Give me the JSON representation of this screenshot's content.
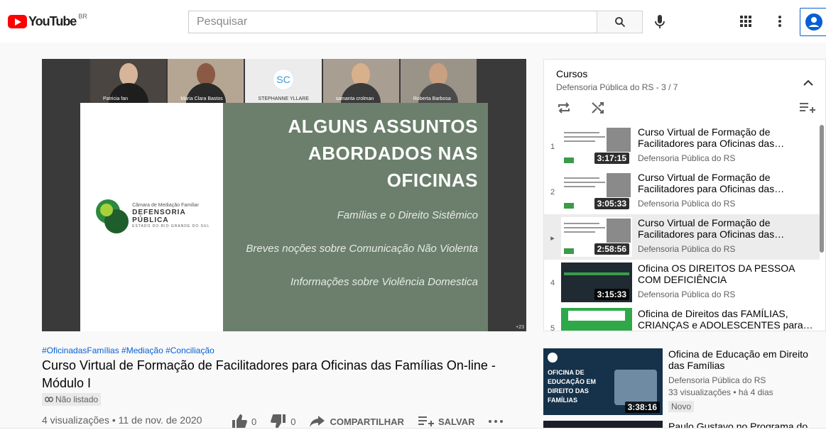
{
  "header": {
    "logo_text": "YouTube",
    "logo_country": "BR",
    "search_placeholder": "Pesquisar"
  },
  "player": {
    "participants": [
      "Patricia fan",
      "Maria Clara Bastos",
      "STEPHANNE YLLARE",
      "samanta crolman",
      "Roberta Barbosa"
    ],
    "initials": "SC",
    "slide_title_lines": [
      "ALGUNS ASSUNTOS",
      "ABORDADOS NAS",
      "OFICINAS"
    ],
    "slide_items": [
      "Famílias e o Direito Sistêmico",
      "Breves noções sobre Comunicação Não Violenta",
      "Informações sobre Violência Domestica"
    ],
    "logo_sub": "Câmara de Mediação Familiar",
    "logo_name": "DEFENSORIA PÚBLICA",
    "logo_state": "ESTADO DO RIO GRANDE DO SUL",
    "participants_badge": "+23"
  },
  "video": {
    "tags": "#OficinadasFamílias #Mediação #Conciliação",
    "title": "Curso Virtual de Formação de Facilitadores para Oficinas das Famílias On-line - Módulo I",
    "unlisted": "Não listado",
    "meta": "4 visualizações • 11 de nov. de 2020",
    "likes": "0",
    "dislikes": "0",
    "share": "COMPARTILHAR",
    "save": "SALVAR"
  },
  "playlist": {
    "title": "Cursos",
    "subtitle": "Defensoria Pública do RS - 3 / 7",
    "items": [
      {
        "index": "1",
        "title": "Curso Virtual de Formação de Facilitadores para Oficinas das…",
        "channel": "Defensoria Pública do RS",
        "duration": "3:17:15",
        "thumb": "white"
      },
      {
        "index": "2",
        "title": "Curso Virtual de Formação de Facilitadores para Oficinas das…",
        "channel": "Defensoria Pública do RS",
        "duration": "3:05:33",
        "thumb": "white"
      },
      {
        "index": "▸",
        "title": "Curso Virtual de Formação de Facilitadores para Oficinas das…",
        "channel": "Defensoria Pública do RS",
        "duration": "2:58:56",
        "thumb": "white"
      },
      {
        "index": "4",
        "title": "Oficina OS DIREITOS DA PESSOA COM DEFICIÊNCIA",
        "channel": "Defensoria Pública do RS",
        "duration": "3:15:33",
        "thumb": "dark"
      },
      {
        "index": "5",
        "title": "Oficina de Direitos das FAMÍLIAS, CRIANÇAS e ADOLESCENTES para…",
        "channel": "",
        "duration": "",
        "thumb": "green"
      }
    ]
  },
  "related": [
    {
      "title": "Oficina de Educação em Direito das Famílias",
      "channel": "Defensoria Pública do RS",
      "views": "33 visualizações • há 4 dias",
      "badge": "Novo",
      "duration": "3:38:16",
      "thumb_text": "OFICINA DE EDUCAÇÃO EM DIREITO DAS FAMÍLIAS"
    },
    {
      "title": "Paulo Gustavo no Programa do"
    }
  ],
  "colors": {
    "brand_red": "#ff0000",
    "link_blue": "#065fd4",
    "slide_green": "#6b7f6c"
  }
}
